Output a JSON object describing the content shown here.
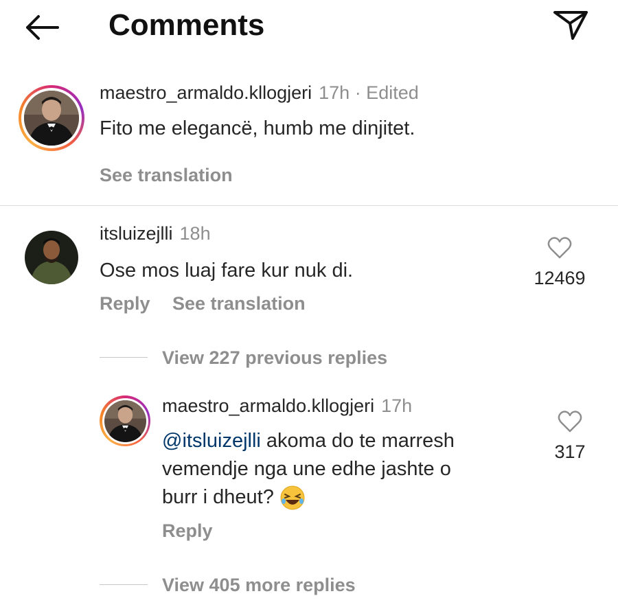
{
  "header": {
    "title": "Comments"
  },
  "caption": {
    "username": "maestro_armaldo.kllogjeri",
    "meta": "17h · Edited",
    "text": "Fito me elegancë, humb me dinjitet.",
    "see_translation": "See translation"
  },
  "comment": {
    "username": "itsluizejlli",
    "time": "18h",
    "text": "Ose mos luaj fare kur nuk di.",
    "likes": "12469",
    "reply": "Reply",
    "see_translation": "See translation"
  },
  "view_previous": "View 227 previous replies",
  "reply": {
    "username": "maestro_armaldo.kllogjeri",
    "time": "17h",
    "mention": "@itsluizejlli",
    "text_line1": " akoma do te marresh",
    "text_line2": "vemendje nga une edhe jashte o",
    "text_line3": "burr i dheut?",
    "likes": "317",
    "reply": "Reply"
  },
  "view_more": "View 405 more replies",
  "icons": {
    "back": "arrow-left-icon",
    "send": "paper-plane-icon",
    "heart": "heart-outline-icon",
    "emoji": "rolling-on-floor-laughing-emoji"
  },
  "colors": {
    "mention": "#00376b",
    "muted": "#8e8e8e",
    "text": "#262626"
  }
}
